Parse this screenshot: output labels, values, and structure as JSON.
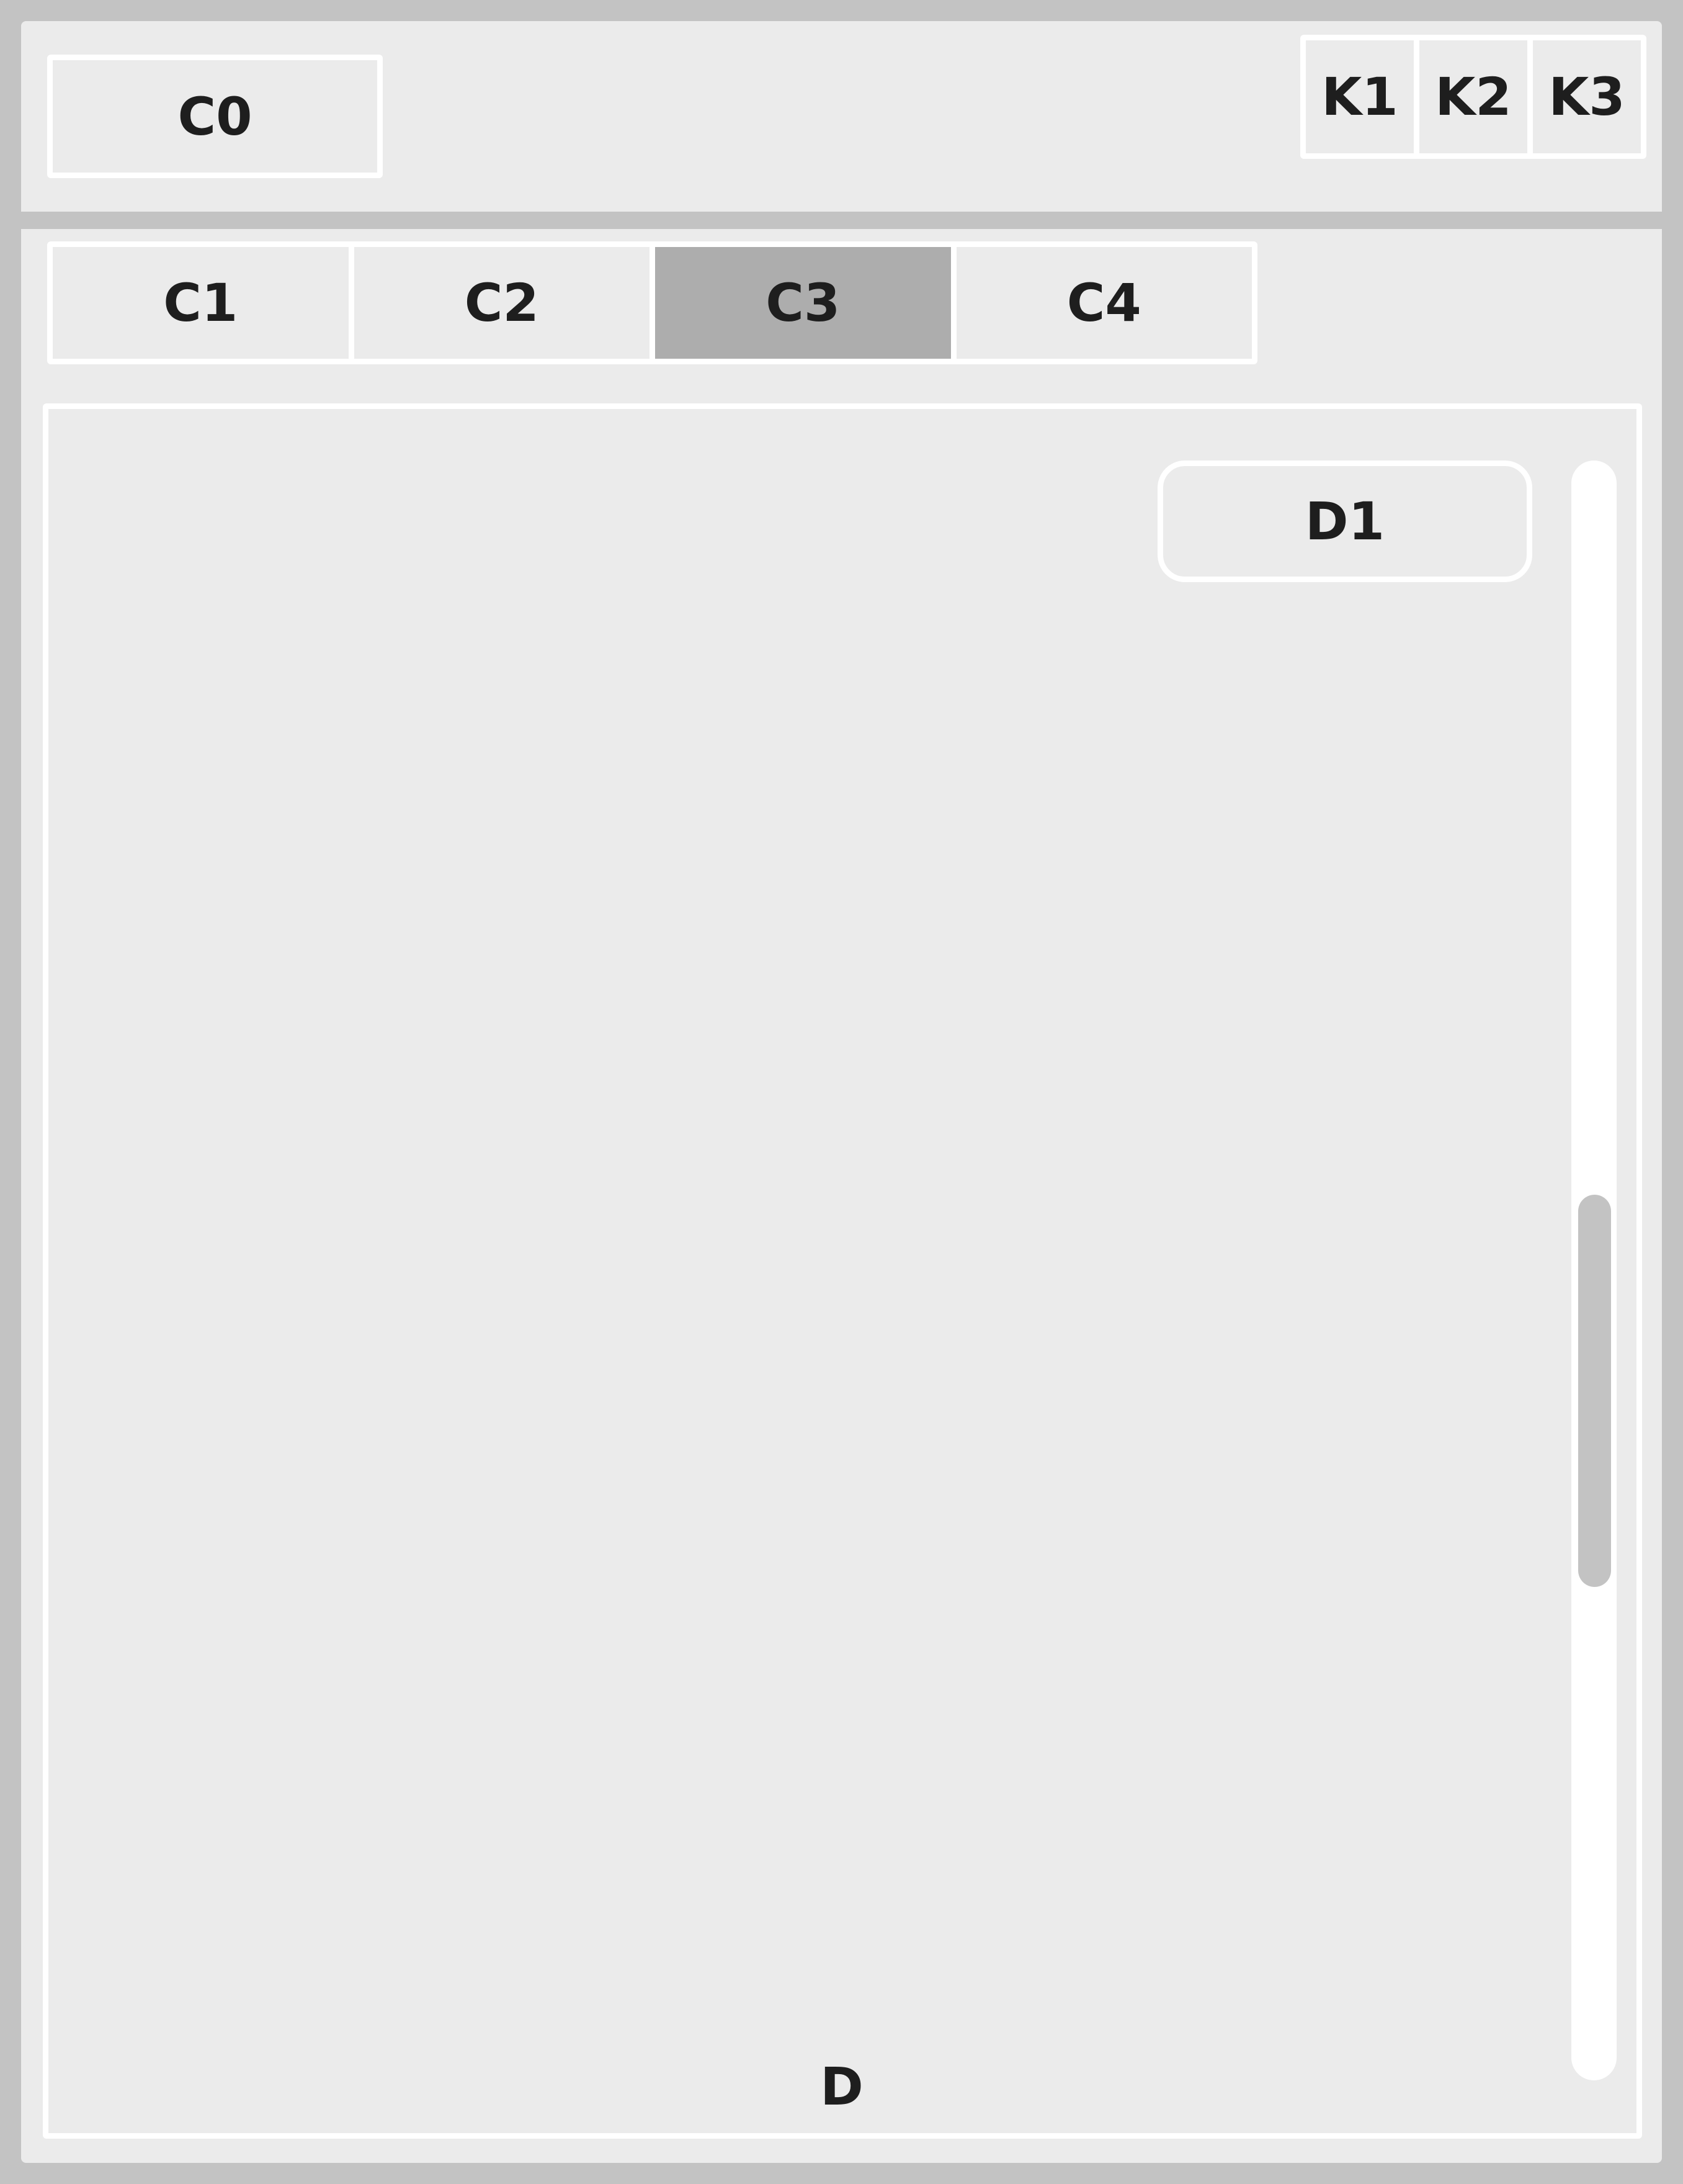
{
  "header": {
    "c0_label": "C0",
    "keys": [
      "K1",
      "K2",
      "K3"
    ]
  },
  "tabs": [
    {
      "label": "C1",
      "active": false
    },
    {
      "label": "C2",
      "active": false
    },
    {
      "label": "C3",
      "active": true
    },
    {
      "label": "C4",
      "active": false
    }
  ],
  "panel": {
    "label": "D",
    "button_label": "D1"
  },
  "colors": {
    "frame": "#c3c3c3",
    "background": "#ebebeb",
    "outline": "#ffffff",
    "active_tab": "#adadad",
    "text": "#1e1e1e"
  }
}
